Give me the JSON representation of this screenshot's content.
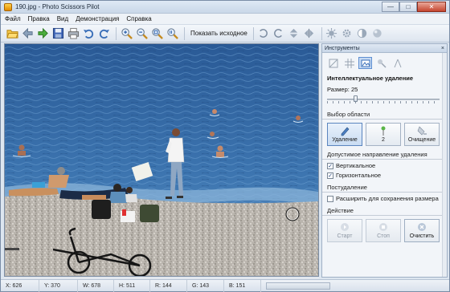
{
  "window": {
    "title": "190.jpg - Photo Scissors Pilot",
    "minimize_label": "—",
    "maximize_label": "□",
    "close_label": "✕"
  },
  "menu": [
    "Файл",
    "Правка",
    "Вид",
    "Демонстрация",
    "Справка"
  ],
  "toolbar": {
    "show_original_label": "Показать исходное"
  },
  "panel": {
    "title": "Инструменты",
    "close_label": "×",
    "heading": "Интеллектуальное удаление",
    "size_label": "Размер: 25",
    "size_value": 25,
    "area_title": "Выбор области",
    "modes": [
      {
        "label": "Удаление",
        "icon": "pencil-icon",
        "active": true
      },
      {
        "label": "2",
        "icon": "pin-icon",
        "active": false
      },
      {
        "label": "Очищение",
        "icon": "eraser-icon",
        "active": false
      }
    ],
    "direction_title": "Допустимое направление удаления",
    "vertical_label": "Вертикальное",
    "vertical_checked": true,
    "horizontal_label": "Горизонтальное",
    "horizontal_checked": true,
    "post_title": "Постудаление",
    "expand_label": "Расширить для сохранения размера",
    "expand_checked": false,
    "action_title": "Действие",
    "actions": [
      {
        "label": "Старт",
        "enabled": false
      },
      {
        "label": "Стоп",
        "enabled": false
      },
      {
        "label": "Очистить",
        "enabled": true
      }
    ]
  },
  "status": {
    "x": "X: 626",
    "y": "Y: 370",
    "w": "W: 678",
    "h": "H: 511",
    "r": "R: 144",
    "g": "G: 143",
    "b": "B: 151"
  },
  "colors": {
    "sea_deep": "#2d5f9a",
    "sea_light": "#4d86bd",
    "pebbles": "#b9b4ad",
    "active_blue": "#5d8ed1"
  }
}
